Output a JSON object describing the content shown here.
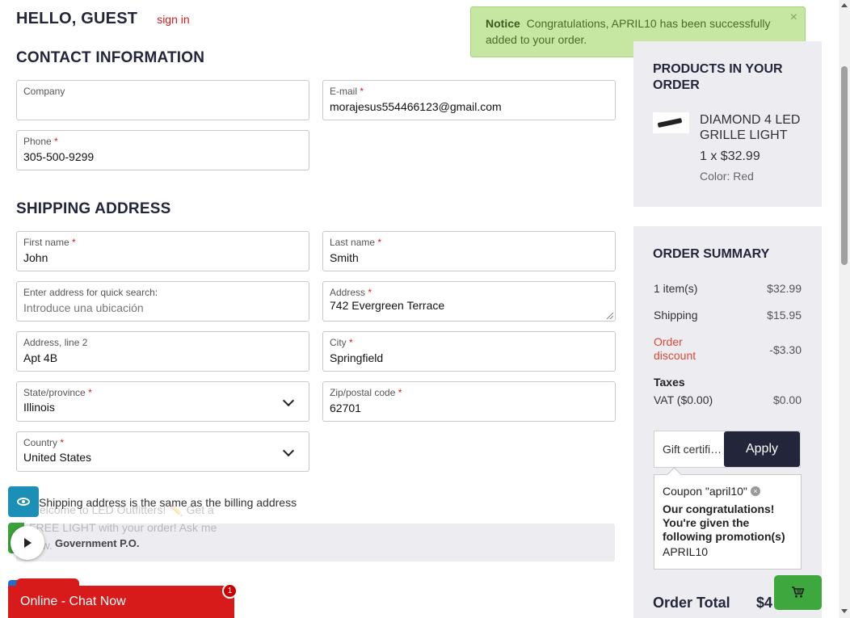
{
  "header": {
    "greeting": "HELLO, GUEST",
    "sign_in": "sign in"
  },
  "notice": {
    "title": "Notice",
    "message": "Congratulations, APRIL10 has been successfully added to your order.",
    "close": "×"
  },
  "contact": {
    "title": "CONTACT INFORMATION",
    "company": {
      "label": "Company",
      "value": ""
    },
    "email": {
      "label": "E-mail",
      "value": "morajesus554466123@gmail.com"
    },
    "phone": {
      "label": "Phone",
      "value": "305-500-9299"
    }
  },
  "shipping": {
    "title": "SHIPPING ADDRESS",
    "first_name": {
      "label": "First name",
      "value": "John"
    },
    "last_name": {
      "label": "Last name",
      "value": "Smith"
    },
    "quick_search": {
      "label": "Enter address for quick search:",
      "placeholder": "Introduce una ubicación"
    },
    "address": {
      "label": "Address",
      "value": "742 Evergreen Terrace"
    },
    "address2": {
      "label": "Address, line 2",
      "value": "Apt 4B"
    },
    "city": {
      "label": "City",
      "value": "Springfield"
    },
    "state": {
      "label": "State/province",
      "value": "Illinois"
    },
    "zip": {
      "label": "Zip/postal code",
      "value": "62701"
    },
    "country": {
      "label": "Country",
      "value": "United States"
    },
    "same_as_billing": "Shipping address is the same as the billing address",
    "government_po": "Government P.O."
  },
  "products": {
    "title": "PRODUCTS IN YOUR ORDER",
    "items": [
      {
        "name": "DIAMOND 4 LED GRILLE LIGHT",
        "qty_price": "1 x $32.99",
        "option": "Color: Red"
      }
    ]
  },
  "summary": {
    "title": "ORDER SUMMARY",
    "items_label": "1 item(s)",
    "items_value": "$32.99",
    "shipping_label": "Shipping",
    "shipping_value": "$15.95",
    "discount_label": "Order discount",
    "discount_value": "-$3.30",
    "taxes_label": "Taxes",
    "vat_label": "VAT ($0.00)",
    "vat_value": "$0.00",
    "gift_placeholder": "Gift certifi…",
    "apply_label": "Apply",
    "coupon_label": "Coupon \"april10\"",
    "coupon_message": "Our congratulations! You're given the following promotion(s)",
    "coupon_code": "APRIL10",
    "total_label": "Order Total",
    "total_value": "$4"
  },
  "chat": {
    "welcome": "Welcome to LED Outfitters! ✏️ Get a FREE LIGHT with your order! Ask me now.",
    "bar_label": "Online - Chat Now",
    "badge": "1"
  },
  "colors": {
    "accent": "#23253a",
    "required": "#d61a1a",
    "notice_bg": "#c6e7a2",
    "chat_red": "#d71b1b",
    "cart_green": "#3ea83e"
  },
  "icons": [
    "close-icon",
    "chevron-down-icon",
    "eye-icon",
    "play-icon",
    "cart-icon",
    "remove-coupon-icon"
  ]
}
